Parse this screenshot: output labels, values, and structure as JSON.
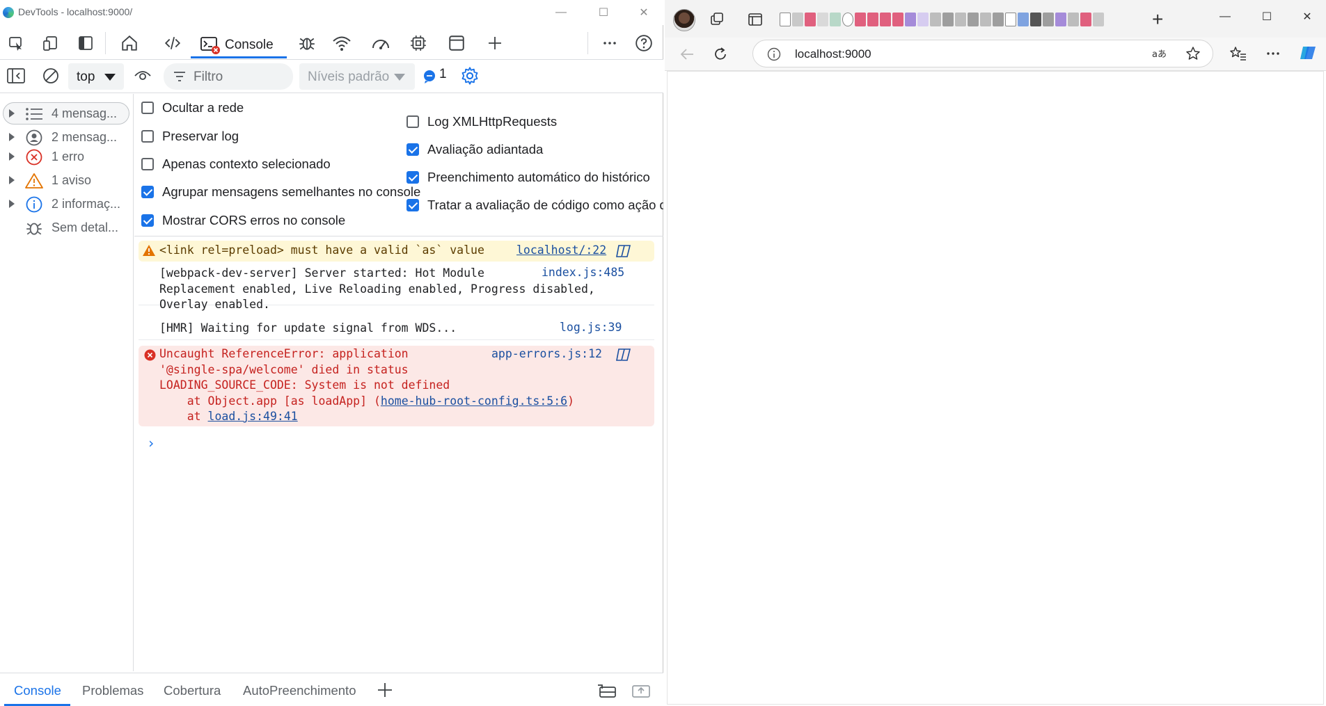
{
  "devtools": {
    "window_title": "DevTools - localhost:9000/",
    "active_tab": "Console",
    "toolbar": {
      "context": "top",
      "filter_placeholder": "Filtro",
      "levels": "Níveis padrão",
      "issues_count": "1"
    },
    "sidebar": {
      "items": [
        {
          "label": "4 mensag...",
          "icon": "list-icon"
        },
        {
          "label": "2 mensag...",
          "icon": "user-icon"
        },
        {
          "label": "1 erro",
          "icon": "error-icon"
        },
        {
          "label": "1 aviso",
          "icon": "warning-icon"
        },
        {
          "label": "2 informaç...",
          "icon": "info-icon"
        },
        {
          "label": "Sem detal...",
          "icon": "bug-icon"
        }
      ]
    },
    "settings": {
      "left": [
        {
          "label": "Ocultar a rede",
          "checked": false
        },
        {
          "label": "Preservar log",
          "checked": false
        },
        {
          "label": "Apenas contexto selecionado",
          "checked": false
        },
        {
          "label": "Agrupar mensagens semelhantes no console",
          "checked": true
        },
        {
          "label": "Mostrar CORS erros no console",
          "checked": true
        }
      ],
      "right": [
        {
          "label": "Log XMLHttpRequests",
          "checked": false
        },
        {
          "label": "Avaliação adiantada",
          "checked": true
        },
        {
          "label": "Preenchimento automático do histórico",
          "checked": true
        },
        {
          "label": "Tratar a avaliação de código como ação d",
          "checked": true
        }
      ]
    },
    "messages": {
      "warning": {
        "text": "<link rel=preload> must have a valid `as` value",
        "source": "localhost/:22"
      },
      "webpack": {
        "text": "[webpack-dev-server] Server started: Hot Module\nReplacement enabled, Live Reloading enabled, Progress disabled,\nOverlay enabled.",
        "source": "index.js:485"
      },
      "hmr": {
        "text": "[HMR] Waiting for update signal from WDS...",
        "source": "log.js:39"
      },
      "error": {
        "line1": "Uncaught ReferenceError: application",
        "line2": "'@single-spa/welcome' died in status",
        "line3": "LOADING_SOURCE_CODE: System is not defined",
        "line4_prefix": "    at Object.app [as loadApp] (",
        "line4_link": "home-hub-root-config.ts:5:6",
        "line4_suffix": ")",
        "line5_prefix": "    at ",
        "line5_link": "load.js:49:41",
        "source": "app-errors.js:12"
      }
    },
    "drawer_tabs": [
      "Console",
      "Problemas",
      "Cobertura",
      "AutoPreenchimento"
    ]
  },
  "browser": {
    "url": "localhost:9000"
  }
}
